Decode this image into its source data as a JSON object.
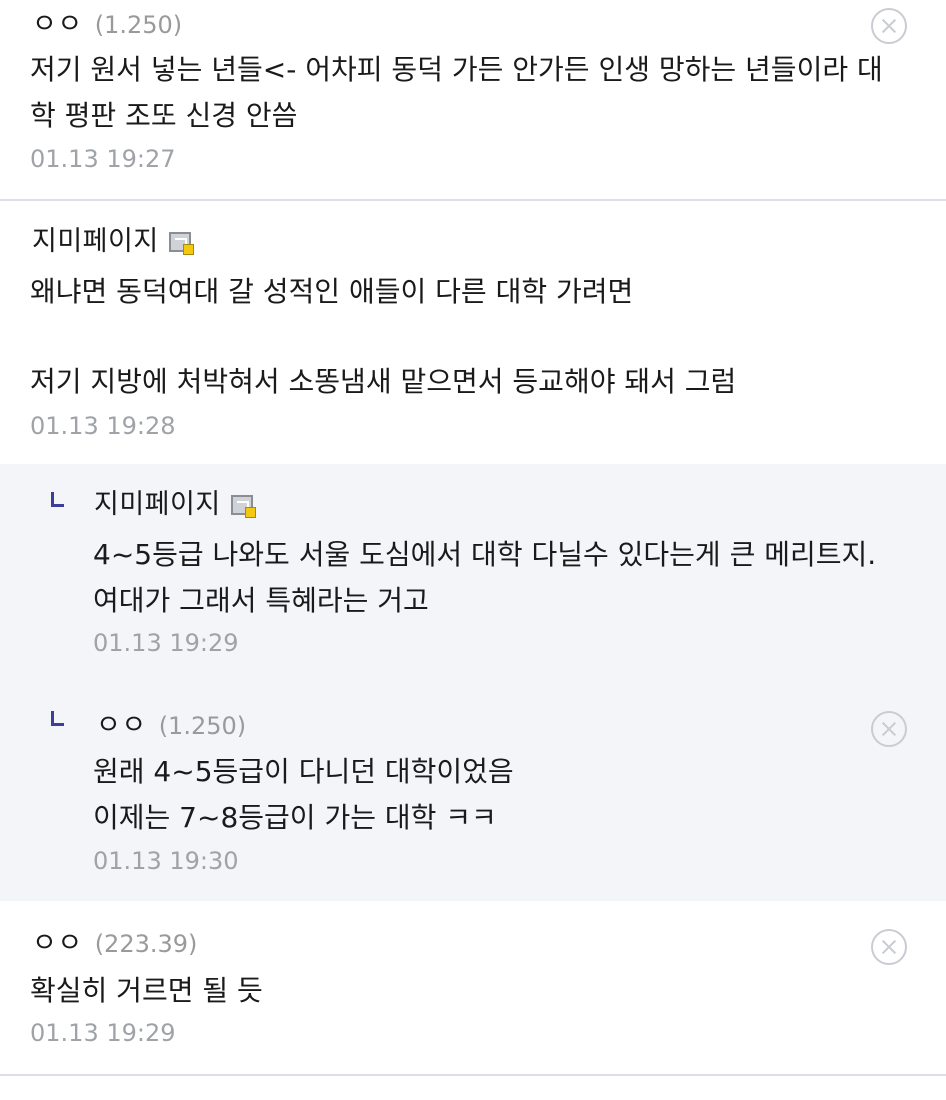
{
  "comments": [
    {
      "nick": "ㅇㅇ",
      "ip": "(1.250)",
      "lines": [
        "저기 원서 넣는 년들<- 어차피 동덕 가든 안가든 인생 망하는 년들이라 대",
        "학 평판 조또 신경 안씀"
      ],
      "time": "01.13 19:27",
      "deletable": true
    },
    {
      "nick": "지미페이지",
      "fixed_icon": "fixed-nick-icon",
      "lines": [
        "왜냐면 동덕여대 갈 성적인 애들이 다른 대학 가려면",
        "",
        "저기 지방에 처박혀서 소똥냄새 맡으면서 등교해야 돼서 그럼"
      ],
      "time": "01.13 19:28"
    },
    {
      "reply": true,
      "nick": "지미페이지",
      "fixed_icon": "fixed-nick-icon",
      "lines": [
        "4~5등급 나와도 서울 도심에서 대학 다닐수 있다는게 큰 메리트지.",
        "여대가 그래서 특혜라는 거고"
      ],
      "time": "01.13 19:29"
    },
    {
      "reply": true,
      "nick": "ㅇㅇ",
      "ip": "(1.250)",
      "lines": [
        "원래 4~5등급이 다니던 대학이었음",
        "이제는 7~8등급이 가는 대학 ㅋㅋ"
      ],
      "time": "01.13 19:30",
      "deletable": true
    },
    {
      "nick": "ㅇㅇ",
      "ip": "(223.39)",
      "lines": [
        "확실히 거르면 될 듯"
      ],
      "time": "01.13 19:29",
      "deletable": true
    }
  ],
  "colors": {
    "reply_background": "#f3f5f9",
    "reply_marker": "#3b3f99",
    "timestamp": "#9fa3a8",
    "fixed_nick_badge": "#f2c811"
  }
}
